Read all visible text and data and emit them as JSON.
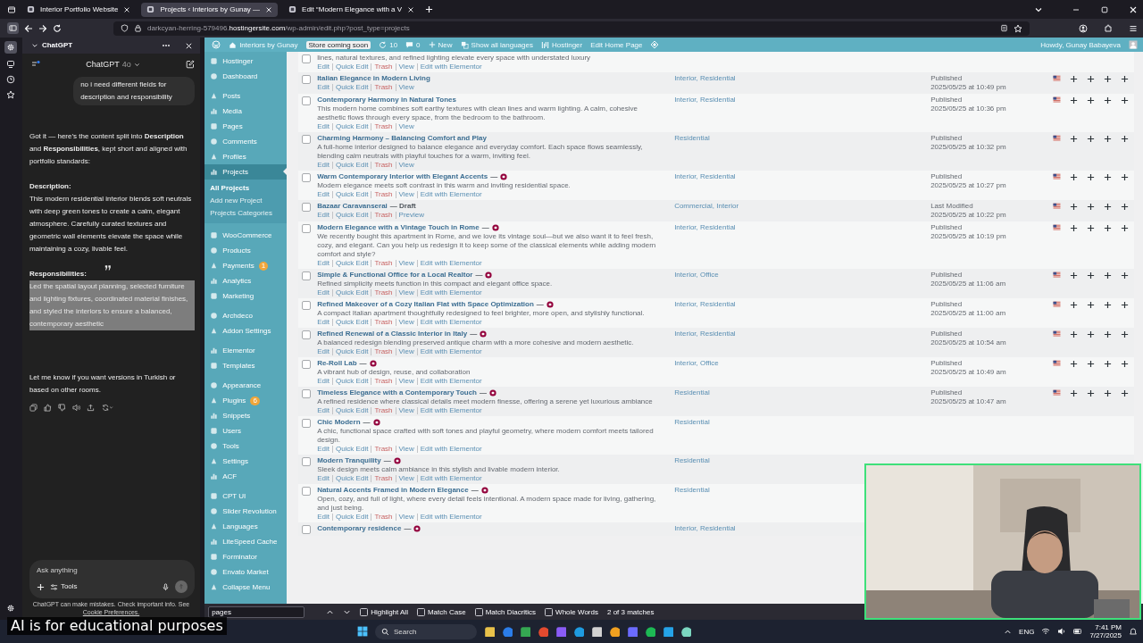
{
  "browser": {
    "tabs": [
      {
        "title": "Interior Portfolio Website",
        "selected": false
      },
      {
        "title": "Projects ‹ Interiors by Gunay —",
        "selected": true
      },
      {
        "title": "Edit “Modern Elegance with a V",
        "selected": false
      }
    ],
    "url": "darkcyan-herring-579496.**hostingersite.com**/wp-admin/edit.php?post_type=projects"
  },
  "chat": {
    "panel_title": "ChatGPT",
    "model": "ChatGPT",
    "model_version": "4o",
    "messages": [
      {
        "kind": "user",
        "text": "no i need different fields for description and responsibility",
        "highlighted": false
      },
      {
        "kind": "paragraph",
        "text": "Got it — here’s the content split into **Description** and **Responsibilities**, kept short and aligned with portfolio standards:",
        "highlighted": false
      },
      {
        "kind": "heading",
        "text": "Description:",
        "highlighted": false
      },
      {
        "kind": "paragraph",
        "text": "This modern residential interior blends soft neutrals with deep green tones to create a calm, elegant atmosphere. Carefully curated textures and geometric wall elements elevate the space while maintaining a cozy, livable feel.",
        "highlighted": false
      },
      {
        "kind": "heading",
        "text": "Responsibilities:",
        "highlighted": false
      },
      {
        "kind": "paragraph",
        "text": "Led the spatial layout planning, selected furniture and lighting fixtures, coordinated material finishes, and styled the interiors to ensure a balanced, contemporary aesthetic",
        "highlighted": true
      },
      {
        "kind": "paragraph",
        "text": "Let me know if you want versions in Turkish or based on other rooms.",
        "highlighted": false
      }
    ],
    "input": {
      "placeholder": "Ask anything"
    },
    "tools_label": "Tools",
    "disclaimer": "ChatGPT can make mistakes. Check important info. See",
    "disclaimer_link": "Cookie Preferences."
  },
  "wp": {
    "admin_bar": {
      "site": "Interiors by Gunay",
      "store_badge": "Store coming soon",
      "updates": "10",
      "comments": "0",
      "new": "New",
      "languages": "Show all languages",
      "hostinger": "Hostinger",
      "edit_page": "Edit Home Page",
      "greeting": "Howdy, Gunay Babayeva"
    },
    "sidebar": {
      "groups": [
        {
          "items": [
            {
              "label": "Hostinger",
              "selected": false
            },
            {
              "label": "Dashboard",
              "selected": false
            }
          ]
        },
        {
          "items": [
            {
              "label": "Posts",
              "selected": false
            },
            {
              "label": "Media",
              "selected": false
            },
            {
              "label": "Pages",
              "selected": false
            },
            {
              "label": "Comments",
              "selected": false
            },
            {
              "label": "Profiles",
              "selected": false
            },
            {
              "label": "Projects",
              "selected": true,
              "children": [
                {
                  "label": "All Projects",
                  "selected": true
                },
                {
                  "label": "Add new Project",
                  "selected": false
                },
                {
                  "label": "Projects Categories",
                  "selected": false
                }
              ]
            }
          ]
        },
        {
          "items": [
            {
              "label": "WooCommerce",
              "selected": false
            },
            {
              "label": "Products",
              "selected": false
            },
            {
              "label": "Payments",
              "selected": false,
              "badge": "1"
            },
            {
              "label": "Analytics",
              "selected": false
            },
            {
              "label": "Marketing",
              "selected": false
            }
          ]
        },
        {
          "items": [
            {
              "label": "Archdeco",
              "selected": false
            },
            {
              "label": "Addon Settings",
              "selected": false
            }
          ]
        },
        {
          "items": [
            {
              "label": "Elementor",
              "selected": false
            },
            {
              "label": "Templates",
              "selected": false
            }
          ]
        },
        {
          "items": [
            {
              "label": "Appearance",
              "selected": false
            },
            {
              "label": "Plugins",
              "selected": false,
              "badge": "6"
            },
            {
              "label": "Snippets",
              "selected": false
            },
            {
              "label": "Users",
              "selected": false
            },
            {
              "label": "Tools",
              "selected": false
            },
            {
              "label": "Settings",
              "selected": false
            },
            {
              "label": "ACF",
              "selected": false
            }
          ]
        },
        {
          "items": [
            {
              "label": "CPT UI",
              "selected": false
            },
            {
              "label": "Slider Revolution",
              "selected": false
            },
            {
              "label": "Languages",
              "selected": false
            },
            {
              "label": "LiteSpeed Cache",
              "selected": false
            },
            {
              "label": "Forminator",
              "selected": false
            },
            {
              "label": "Envato Market",
              "selected": false
            },
            {
              "label": "Collapse Menu",
              "selected": false
            }
          ]
        }
      ]
    },
    "rows": [
      {
        "checked": false,
        "badge": false,
        "description": "lines, natural textures, and refined lighting elevate every space with understated luxury",
        "actions": [
          {
            "label": "Edit",
            "kind": "link"
          },
          {
            "label": "Quick Edit",
            "kind": "link"
          },
          {
            "label": "Trash",
            "kind": "danger"
          },
          {
            "label": "View",
            "kind": "link"
          },
          {
            "label": "Edit with Elementor",
            "kind": "link"
          }
        ]
      },
      {
        "checked": false,
        "badge": false,
        "title": "Italian Elegance in Modern Living",
        "actions": [
          {
            "label": "Edit",
            "kind": "link"
          },
          {
            "label": "Quick Edit",
            "kind": "link"
          },
          {
            "label": "Trash",
            "kind": "danger"
          },
          {
            "label": "View",
            "kind": "link"
          }
        ],
        "categories": "Interior, Residential",
        "status": "Published",
        "date": "2025/05/25 at 10:49 pm"
      },
      {
        "checked": false,
        "badge": false,
        "title": "Contemporary Harmony in Natural Tones",
        "description": "This modern home combines soft earthy textures with clean lines and warm lighting. A calm, cohesive aesthetic flows through every space, from the bedroom to the bathroom.",
        "actions": [
          {
            "label": "Edit",
            "kind": "link"
          },
          {
            "label": "Quick Edit",
            "kind": "link"
          },
          {
            "label": "Trash",
            "kind": "danger"
          },
          {
            "label": "View",
            "kind": "link"
          }
        ],
        "categories": "Interior, Residential",
        "status": "Published",
        "date": "2025/05/25 at 10:36 pm"
      },
      {
        "checked": false,
        "badge": false,
        "title": "Charming Harmony – Balancing Comfort and Play",
        "description": "A full-home interior designed to balance elegance and everyday comfort. Each space flows seamlessly, blending calm neutrals with playful touches for a warm, inviting feel.",
        "actions": [
          {
            "label": "Edit",
            "kind": "link"
          },
          {
            "label": "Quick Edit",
            "kind": "link"
          },
          {
            "label": "Trash",
            "kind": "danger"
          },
          {
            "label": "View",
            "kind": "link"
          }
        ],
        "categories": "Residential",
        "status": "Published",
        "date": "2025/05/25 at 10:32 pm"
      },
      {
        "checked": false,
        "badge": true,
        "title": "Warm Contemporary Interior with Elegant Accents",
        "suffix": "—",
        "description": "Modern elegance meets soft contrast in this warm and inviting residential space.",
        "actions": [
          {
            "label": "Edit",
            "kind": "link"
          },
          {
            "label": "Quick Edit",
            "kind": "link"
          },
          {
            "label": "Trash",
            "kind": "danger"
          },
          {
            "label": "View",
            "kind": "link"
          },
          {
            "label": "Edit with Elementor",
            "kind": "link"
          }
        ],
        "categories": "Interior, Residential",
        "status": "Published",
        "date": "2025/05/25 at 10:27 pm"
      },
      {
        "checked": false,
        "badge": false,
        "title": "Bazaar Caravanserai",
        "suffix": "— Draft",
        "actions": [
          {
            "label": "Edit",
            "kind": "link"
          },
          {
            "label": "Quick Edit",
            "kind": "link"
          },
          {
            "label": "Trash",
            "kind": "danger"
          },
          {
            "label": "Preview",
            "kind": "link"
          }
        ],
        "categories": "Commercial, Interior",
        "status": "Last Modified",
        "date": "2025/05/25 at 10:22 pm"
      },
      {
        "checked": false,
        "badge": true,
        "title": "Modern Elegance with a Vintage Touch in Rome",
        "suffix": "—",
        "description": "We recently bought this apartment in Rome, and we love its vintage soul—but we also want it to feel fresh, cozy, and elegant. Can you help us redesign it to keep some of the classical elements while adding modern comfort and style?",
        "actions": [
          {
            "label": "Edit",
            "kind": "link"
          },
          {
            "label": "Quick Edit",
            "kind": "link"
          },
          {
            "label": "Trash",
            "kind": "danger"
          },
          {
            "label": "View",
            "kind": "link"
          },
          {
            "label": "Edit with Elementor",
            "kind": "link"
          }
        ],
        "categories": "Interior, Residential",
        "status": "Published",
        "date": "2025/05/25 at 10:19 pm"
      },
      {
        "checked": false,
        "badge": true,
        "title": "Simple & Functional Office for a Local Realtor",
        "suffix": "—",
        "description": "Refined simplicity meets function in this compact and elegant office space.",
        "actions": [
          {
            "label": "Edit",
            "kind": "link"
          },
          {
            "label": "Quick Edit",
            "kind": "link"
          },
          {
            "label": "Trash",
            "kind": "danger"
          },
          {
            "label": "View",
            "kind": "link"
          },
          {
            "label": "Edit with Elementor",
            "kind": "link"
          }
        ],
        "categories": "Interior, Office",
        "status": "Published",
        "date": "2025/05/25 at 11:06 am"
      },
      {
        "checked": false,
        "badge": true,
        "title": "Refined Makeover of a Cozy Italian Flat with Space Optimization",
        "suffix": "—",
        "description": "A compact Italian apartment thoughtfully redesigned to feel brighter, more open, and stylishly functional.",
        "actions": [
          {
            "label": "Edit",
            "kind": "link"
          },
          {
            "label": "Quick Edit",
            "kind": "link"
          },
          {
            "label": "Trash",
            "kind": "danger"
          },
          {
            "label": "View",
            "kind": "link"
          },
          {
            "label": "Edit with Elementor",
            "kind": "link"
          }
        ],
        "categories": "Interior, Residential",
        "status": "Published",
        "date": "2025/05/25 at 11:00 am"
      },
      {
        "checked": false,
        "badge": true,
        "title": "Refined Renewal of a Classic Interior in Italy",
        "suffix": "—",
        "description": "A balanced redesign blending preserved antique charm with a more cohesive and modern aesthetic.",
        "actions": [
          {
            "label": "Edit",
            "kind": "link"
          },
          {
            "label": "Quick Edit",
            "kind": "link"
          },
          {
            "label": "Trash",
            "kind": "danger"
          },
          {
            "label": "View",
            "kind": "link"
          },
          {
            "label": "Edit with Elementor",
            "kind": "link"
          }
        ],
        "categories": "Interior, Residential",
        "status": "Published",
        "date": "2025/05/25 at 10:54 am"
      },
      {
        "checked": false,
        "badge": true,
        "title": "Re-Roll Lab",
        "suffix": "—",
        "description": "A vibrant hub of design, reuse, and collaboration",
        "actions": [
          {
            "label": "Edit",
            "kind": "link"
          },
          {
            "label": "Quick Edit",
            "kind": "link"
          },
          {
            "label": "Trash",
            "kind": "danger"
          },
          {
            "label": "View",
            "kind": "link"
          },
          {
            "label": "Edit with Elementor",
            "kind": "link"
          }
        ],
        "categories": "Interior, Office",
        "status": "Published",
        "date": "2025/05/25 at 10:49 am"
      },
      {
        "checked": false,
        "badge": true,
        "title": "Timeless Elegance with a Contemporary Touch",
        "suffix": "—",
        "description": "A refined residence where classical details meet modern finesse, offering a serene yet luxurious ambiance",
        "actions": [
          {
            "label": "Edit",
            "kind": "link"
          },
          {
            "label": "Quick Edit",
            "kind": "link"
          },
          {
            "label": "Trash",
            "kind": "danger"
          },
          {
            "label": "View",
            "kind": "link"
          },
          {
            "label": "Edit with Elementor",
            "kind": "link"
          }
        ],
        "categories": "Residential",
        "status": "Published",
        "date": "2025/05/25 at 10:47 am"
      },
      {
        "checked": false,
        "badge": true,
        "title": "Chic Modern",
        "suffix": "—",
        "description": "A chic, functional space crafted with soft tones and playful geometry, where modern comfort meets tailored design.",
        "actions": [
          {
            "label": "Edit",
            "kind": "link"
          },
          {
            "label": "Quick Edit",
            "kind": "link"
          },
          {
            "label": "Trash",
            "kind": "danger"
          },
          {
            "label": "View",
            "kind": "link"
          },
          {
            "label": "Edit with Elementor",
            "kind": "link"
          }
        ],
        "categories": "Residential"
      },
      {
        "checked": false,
        "badge": true,
        "title": "Modern Tranquility",
        "suffix": "—",
        "description": "Sleek design meets calm ambiance in this stylish and livable modern interior.",
        "actions": [
          {
            "label": "Edit",
            "kind": "link"
          },
          {
            "label": "Quick Edit",
            "kind": "link"
          },
          {
            "label": "Trash",
            "kind": "danger"
          },
          {
            "label": "View",
            "kind": "link"
          },
          {
            "label": "Edit with Elementor",
            "kind": "link"
          }
        ],
        "categories": "Residential"
      },
      {
        "checked": false,
        "badge": true,
        "title": "Natural Accents Framed in Modern Elegance",
        "suffix": "—",
        "description": "Open, cozy, and full of light, where every detail feels intentional. A modern space made for living, gathering, and just being.",
        "actions": [
          {
            "label": "Edit",
            "kind": "link"
          },
          {
            "label": "Quick Edit",
            "kind": "link"
          },
          {
            "label": "Trash",
            "kind": "danger"
          },
          {
            "label": "View",
            "kind": "link"
          },
          {
            "label": "Edit with Elementor",
            "kind": "link"
          }
        ],
        "categories": "Residential"
      },
      {
        "checked": false,
        "badge": true,
        "title": "Contemporary residence",
        "suffix": "—",
        "categories": "Interior, Residential"
      }
    ]
  },
  "find_bar": {
    "query": "pages",
    "options": [
      {
        "label": "Highlight All",
        "checked": false
      },
      {
        "label": "Match Case",
        "checked": false
      },
      {
        "label": "Match Diacritics",
        "checked": false
      },
      {
        "label": "Whole Words",
        "checked": false
      }
    ],
    "result": "2 of 3 matches"
  },
  "taskbar": {
    "search": "Search",
    "language": "ENG",
    "time": "7:41 PM",
    "date": "7/27/2025"
  },
  "caption": {
    "text": "AI is for educational purposes"
  }
}
